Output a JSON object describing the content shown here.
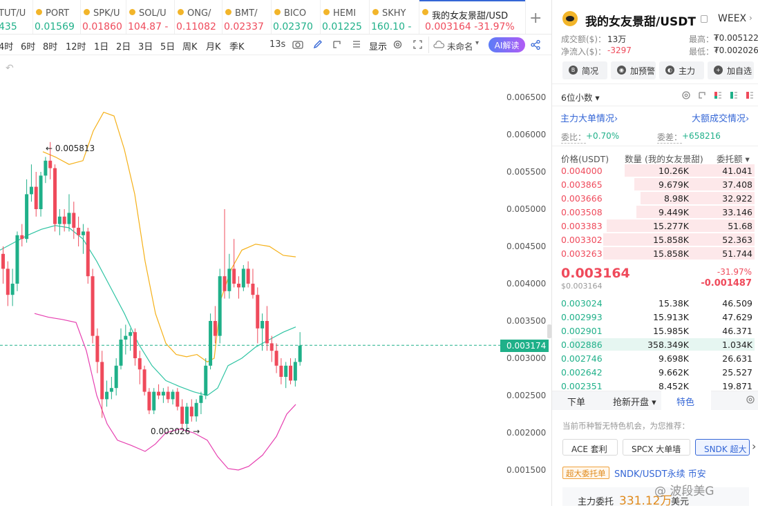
{
  "tabs": [
    {
      "name": "TUT/U",
      "price": "435",
      "dir": "up"
    },
    {
      "name": "PORT",
      "price": "0.01569",
      "dir": "up"
    },
    {
      "name": "SPK/U",
      "price": "0.01860",
      "dir": "dn"
    },
    {
      "name": "SOL/U",
      "price": "104.87 -",
      "dir": "dn"
    },
    {
      "name": "ONG/",
      "price": "0.11082",
      "dir": "dn"
    },
    {
      "name": "BMT/",
      "price": "0.02337",
      "dir": "dn"
    },
    {
      "name": "BICO",
      "price": "0.02370",
      "dir": "up"
    },
    {
      "name": "HEMI",
      "price": "0.01225",
      "dir": "up"
    },
    {
      "name": "SKHY",
      "price": "160.10 -",
      "dir": "up"
    },
    {
      "name": "我的女友景甜/USD",
      "price": "0.003164",
      "change": "-31.97%",
      "dir": "dn"
    }
  ],
  "toolbar": {
    "timeframes": [
      "4时",
      "6时",
      "8时",
      "12时",
      "1日",
      "2日",
      "3日",
      "5日",
      "周K",
      "月K",
      "季K"
    ],
    "countdown": "13s",
    "display": "显示",
    "layout_name": "未命名",
    "ai": "AI解读"
  },
  "chart": {
    "y_ticks": [
      "0.006500",
      "0.006000",
      "0.005500",
      "0.005000",
      "0.004500",
      "0.004000",
      "0.003500",
      "0.003000",
      "0.002500",
      "0.002000",
      "0.001500"
    ],
    "current_price": "0.003174",
    "high_label": "0.005813",
    "low_label": "0.002026",
    "colors": {
      "up": "#1fb089",
      "down": "#ef4a5b",
      "ma": "#2ec4a3",
      "upper": "#f5b017",
      "lower": "#e63fb0"
    }
  },
  "panel": {
    "title": "我的女友景甜/USDT",
    "exchange": "WEEX",
    "turnover_label": "成交额($)：",
    "turnover": "13万",
    "net_label": "净流入($)：",
    "net": "-3297",
    "high_label": "最高：",
    "high": "₮0.005122",
    "low_label": "最低：",
    "low": "₮0.002026",
    "buttons": [
      "简况",
      "加预警",
      "主力",
      "加自选"
    ],
    "decimals": "6位小数",
    "link_left": "主力大单情况",
    "link_right": "大额成交情况",
    "ratio_label": "委比：",
    "ratio": "+0.70%",
    "diff_label": "委差：",
    "diff": "+658216",
    "headers": [
      "价格(USDT)",
      "数量 (我的女友景甜)",
      "委托额"
    ],
    "asks": [
      {
        "price": "0.004000",
        "qty": "10.26K",
        "amt": "41.041",
        "w": 0.41
      },
      {
        "price": "0.003865",
        "qty": "9.679K",
        "amt": "37.408",
        "w": 0.38
      },
      {
        "price": "0.003666",
        "qty": "8.98K",
        "amt": "32.922",
        "w": 0.34
      },
      {
        "price": "0.003508",
        "qty": "9.449K",
        "amt": "33.146",
        "w": 0.36
      },
      {
        "price": "0.003383",
        "qty": "15.277K",
        "amt": "51.68",
        "w": 0.58
      },
      {
        "price": "0.003302",
        "qty": "15.858K",
        "amt": "52.363",
        "w": 0.6
      },
      {
        "price": "0.003263",
        "qty": "15.858K",
        "amt": "51.744",
        "w": 0.6
      }
    ],
    "last_price": "0.003164",
    "last_usd": "$0.003164",
    "last_change": "-31.97%",
    "last_diff": "-0.001487",
    "bids": [
      {
        "price": "0.003024",
        "qty": "15.38K",
        "amt": "46.509",
        "w": 0.0
      },
      {
        "price": "0.002993",
        "qty": "15.913K",
        "amt": "47.629",
        "w": 0.0
      },
      {
        "price": "0.002901",
        "qty": "15.985K",
        "amt": "46.371",
        "w": 0.0
      },
      {
        "price": "0.002886",
        "qty": "358.349K",
        "amt": "1.034K",
        "w": 1.0
      },
      {
        "price": "0.002746",
        "qty": "9.698K",
        "amt": "26.631",
        "w": 0.0
      },
      {
        "price": "0.002642",
        "qty": "9.662K",
        "amt": "25.527",
        "w": 0.0
      },
      {
        "price": "0.002351",
        "qty": "8.452K",
        "amt": "19.871",
        "w": 0.0
      }
    ],
    "bottom_tabs": [
      "下单",
      "抢新开盘",
      "特色"
    ],
    "notice": "当前币种暂无特色机会，为您推荐：",
    "chips": [
      "ACE 套利",
      "SPCX 大单墙",
      "SNDK 超大"
    ],
    "badge": "超大委托单",
    "badge_text": "SNDK/USDT永续 币安",
    "main_label": "主力委托",
    "main_value": "331.12万",
    "main_unit": "美元",
    "watermark": "@ 波段美G"
  }
}
